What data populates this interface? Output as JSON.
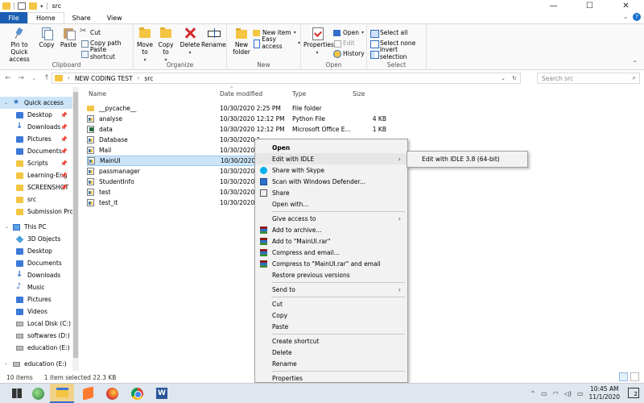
{
  "window": {
    "title": "src"
  },
  "ribbon_tabs": [
    "File",
    "Home",
    "Share",
    "View"
  ],
  "ribbon": {
    "clipboard": {
      "label": "Clipboard",
      "pin_label": "Pin to Quick access",
      "copy_label": "Copy",
      "paste_label": "Paste",
      "cut_label": "Cut",
      "copy_path_label": "Copy path",
      "paste_shortcut_label": "Paste shortcut"
    },
    "organize": {
      "label": "Organize",
      "move_to_label": "Move to",
      "copy_to_label": "Copy to",
      "delete_label": "Delete",
      "rename_label": "Rename"
    },
    "new": {
      "label": "New",
      "new_folder_label": "New folder",
      "new_item_label": "New item",
      "easy_access_label": "Easy access"
    },
    "open": {
      "label": "Open",
      "properties_label": "Properties",
      "open_label": "Open",
      "edit_label": "Edit",
      "history_label": "History"
    },
    "select": {
      "label": "Select",
      "select_all_label": "Select all",
      "select_none_label": "Select none",
      "invert_label": "Invert selection"
    }
  },
  "address": {
    "crumbs": [
      "NEW CODING TEST",
      "src"
    ],
    "search_placeholder": "Search src"
  },
  "nav": {
    "quick_access": "Quick access",
    "items": [
      "Desktop",
      "Downloads",
      "Pictures",
      "Documents",
      "Scripts",
      "Learning-Eng",
      "SCREENSHOT",
      "src",
      "Submission Proj"
    ],
    "this_pc": "This PC",
    "pc_items": [
      "3D Objects",
      "Desktop",
      "Documents",
      "Downloads",
      "Music",
      "Pictures",
      "Videos",
      "Local Disk (C:)",
      "softwares (D:)",
      "education (E:)"
    ],
    "network_drive": "education (E:)"
  },
  "columns": {
    "name": "Name",
    "date": "Date modified",
    "type": "Type",
    "size": "Size"
  },
  "files": [
    {
      "name": "__pycache__",
      "date": "10/30/2020 2:25 PM",
      "type": "File folder",
      "size": ""
    },
    {
      "name": "analyse",
      "date": "10/30/2020 12:12 PM",
      "type": "Python File",
      "size": "4 KB"
    },
    {
      "name": "data",
      "date": "10/30/2020 12:12 PM",
      "type": "Microsoft Office E...",
      "size": "1 KB"
    },
    {
      "name": "Database",
      "date": "10/30/2020 1",
      "type": "",
      "size": ""
    },
    {
      "name": "Mail",
      "date": "10/30/2020 1",
      "type": "",
      "size": ""
    },
    {
      "name": "MainUI",
      "date": "10/30/2020 1",
      "type": "",
      "size": ""
    },
    {
      "name": "passmanager",
      "date": "10/30/2020 1",
      "type": "",
      "size": ""
    },
    {
      "name": "StudentInfo",
      "date": "10/30/2020 1",
      "type": "",
      "size": ""
    },
    {
      "name": "test",
      "date": "10/30/2020 1",
      "type": "",
      "size": ""
    },
    {
      "name": "test_it",
      "date": "10/30/2020 2",
      "type": "",
      "size": ""
    }
  ],
  "context_menu": {
    "open": "Open",
    "edit_idle": "Edit with IDLE",
    "share_skype": "Share with Skype",
    "scan_defender": "Scan with Windows Defender...",
    "share": "Share",
    "open_with": "Open with...",
    "give_access": "Give access to",
    "add_archive": "Add to archive...",
    "add_rar": "Add to \"MainUI.rar\"",
    "compress_email": "Compress and email...",
    "compress_rar_email": "Compress to \"MainUI.rar\" and email",
    "restore": "Restore previous versions",
    "send_to": "Send to",
    "cut": "Cut",
    "copy": "Copy",
    "paste": "Paste",
    "create_shortcut": "Create shortcut",
    "delete": "Delete",
    "rename": "Rename",
    "properties": "Properties"
  },
  "submenu": {
    "idle_64": "Edit with IDLE 3.8 (64-bit)"
  },
  "status": {
    "items": "10 items",
    "selected": "1 item selected  22.3 KB"
  },
  "taskbar": {
    "time": "10:45 AM",
    "date": "11/1/2020",
    "notifications": "2"
  },
  "colors": {
    "accent": "#1a5fb4",
    "selection": "#cce4f7",
    "folder": "#f4c542"
  }
}
